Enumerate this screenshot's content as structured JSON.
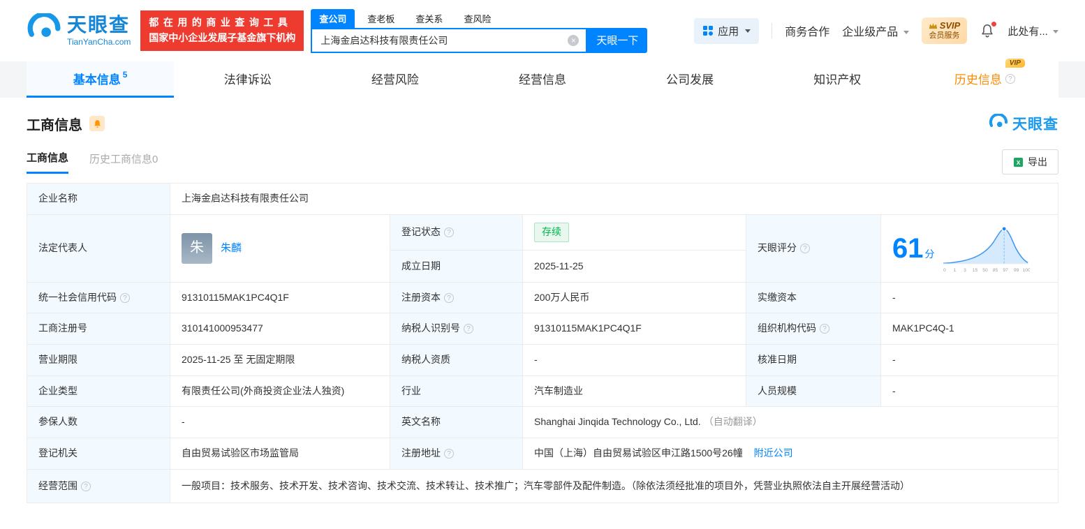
{
  "header": {
    "brand": "天眼查",
    "brand_domain": "TianYanCha.com",
    "promo_line1": "都在用的商业查询工具",
    "promo_line2": "国家中小企业发展子基金旗下机构",
    "search_tabs": [
      {
        "label": "查公司"
      },
      {
        "label": "查老板"
      },
      {
        "label": "查关系"
      },
      {
        "label": "查风险"
      }
    ],
    "search_value": "上海金启达科技有限责任公司",
    "search_button": "天眼一下",
    "apps_label": "应用",
    "biz_coop": "商务合作",
    "enterprise_product": "企业级产品",
    "svip_title": "SVIP",
    "svip_sub": "会员服务",
    "user_label": "此处有..."
  },
  "nav": {
    "tabs": [
      {
        "label": "基本信息",
        "count": "5"
      },
      {
        "label": "法律诉讼"
      },
      {
        "label": "经营风险"
      },
      {
        "label": "经营信息"
      },
      {
        "label": "公司发展"
      },
      {
        "label": "知识产权"
      },
      {
        "label": "历史信息",
        "vip": "VIP"
      }
    ]
  },
  "section": {
    "title": "工商信息",
    "brand": "天眼查",
    "tab_current": "工商信息",
    "tab_history": "历史工商信息0",
    "export": "导出"
  },
  "table": {
    "company_name": {
      "label": "企业名称",
      "value": "上海金启达科技有限责任公司"
    },
    "legal_rep": {
      "label": "法定代表人",
      "avatar": "朱",
      "name": "朱麟"
    },
    "reg_status": {
      "label": "登记状态",
      "value": "存续"
    },
    "establish_date": {
      "label": "成立日期",
      "value": "2025-11-25"
    },
    "score": {
      "label": "天眼评分",
      "value": "61",
      "unit": "分",
      "axis": [
        "0",
        "1",
        "3",
        "15",
        "50",
        "85",
        "97",
        "99",
        "100"
      ]
    },
    "credit_code": {
      "label": "统一社会信用代码",
      "value": "91310115MAK1PC4Q1F"
    },
    "reg_capital": {
      "label": "注册资本",
      "value": "200万人民币"
    },
    "paid_capital": {
      "label": "实缴资本",
      "value": "-"
    },
    "reg_number": {
      "label": "工商注册号",
      "value": "310141000953477"
    },
    "taxpayer_id": {
      "label": "纳税人识别号",
      "value": "91310115MAK1PC4Q1F"
    },
    "org_code": {
      "label": "组织机构代码",
      "value": "MAK1PC4Q-1"
    },
    "business_term": {
      "label": "营业期限",
      "value": "2025-11-25 至 无固定期限"
    },
    "taxpayer_quality": {
      "label": "纳税人资质",
      "value": "-"
    },
    "approval_date": {
      "label": "核准日期",
      "value": "-"
    },
    "company_type": {
      "label": "企业类型",
      "value": "有限责任公司(外商投资企业法人独资)"
    },
    "industry": {
      "label": "行业",
      "value": "汽车制造业"
    },
    "staff_size": {
      "label": "人员规模",
      "value": "-"
    },
    "insured_count": {
      "label": "参保人数",
      "value": "-"
    },
    "english_name": {
      "label": "英文名称",
      "value": "Shanghai Jinqida Technology Co., Ltd.",
      "note": "（自动翻译）"
    },
    "reg_authority": {
      "label": "登记机关",
      "value": "自由贸易试验区市场监管局"
    },
    "reg_address": {
      "label": "注册地址",
      "value": "中国（上海）自由贸易试验区申江路1500号26幢",
      "nearby": "附近公司"
    },
    "business_scope": {
      "label": "经营范围",
      "value": "一般项目：技术服务、技术开发、技术咨询、技术交流、技术转让、技术推广；汽车零部件及配件制造。（除依法须经批准的项目外，凭营业执照依法自主开展经营活动）"
    }
  }
}
